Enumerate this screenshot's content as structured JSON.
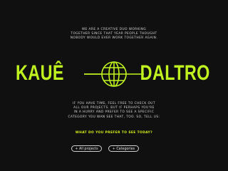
{
  "intro": {
    "lines": [
      "WE ARE A CREATIVE DUO WORKING",
      "TOGETHER SINCE THAT YEAR PEOPLE THOUGHT",
      "NOBODY WOULD EVER WORK TOGETHER AGAIN."
    ]
  },
  "brand": {
    "first_name": "KAUÊ",
    "last_name": "DALTRO",
    "color": "#bff21f"
  },
  "body": {
    "lines": [
      "IF YOU HAVE TIME, FEEL FREE TO CHECK OUT",
      "ALL OUR PROJECTS. BUT IF PERHAPS YOU'RE",
      "IN A HURRY AND PREFER TO SEE A SPECIFIC",
      "CATEGORY YOU WAN SEE THAT, TOO. SO, TELL US:"
    ]
  },
  "question": {
    "text": "WHAT DO YOU PREFER TO SEE TODAY?",
    "color": "#d7f21a"
  },
  "buttons": {
    "all_projects": {
      "icon": "+",
      "label": "All projects"
    },
    "categories": {
      "icon": "+",
      "label": "Categories"
    }
  }
}
